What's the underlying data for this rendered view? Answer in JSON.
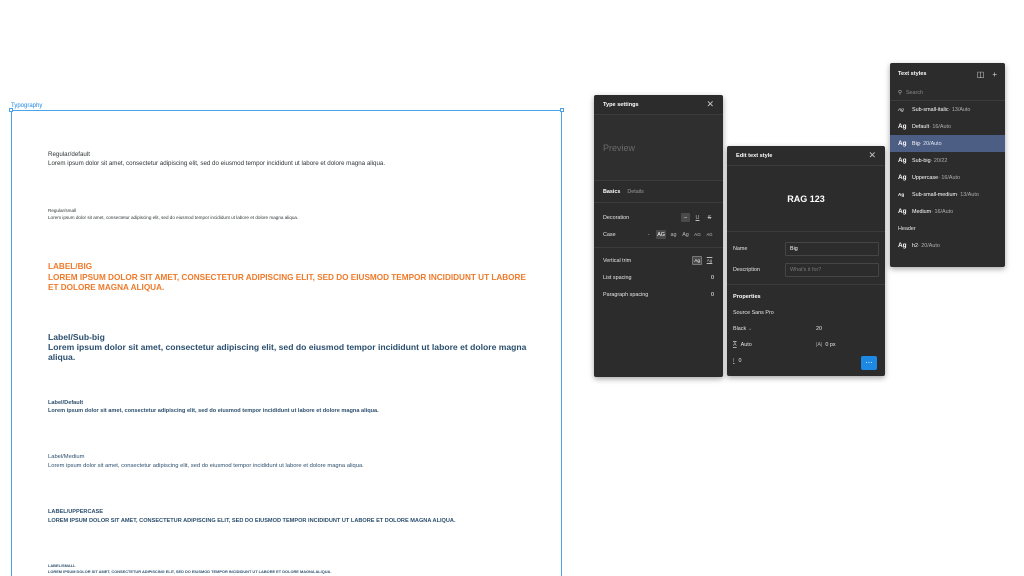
{
  "frame": {
    "label": "Typography"
  },
  "samples": [
    {
      "name": "Regular/default",
      "text": "Lorem ipsum dolor sit amet, consectetur adipiscing elit, sed do eiusmod tempor incididunt ut labore et dolore magna aliqua."
    },
    {
      "name": "Regular/small",
      "text": "Lorem ipsum dolor sit amet, consectetur adipiscing elit, sed do eiusmod tempor incididunt ut labore et dolore magna aliqua."
    },
    {
      "name": "LABEL/BIG",
      "text": "LOREM IPSUM DOLOR SIT AMET, CONSECTETUR ADIPISCING ELIT, SED DO EIUSMOD TEMPOR INCIDIDUNT UT LABORE ET DOLORE MAGNA ALIQUA."
    },
    {
      "name": "Label/Sub-big",
      "text": "Lorem ipsum dolor sit amet, consectetur adipiscing elit, sed do eiusmod tempor incididunt ut labore et dolore magna aliqua."
    },
    {
      "name": "Label/Default",
      "text": "Lorem ipsum dolor sit amet, consectetur adipiscing elit, sed do eiusmod tempor incididunt ut labore et dolore magna aliqua."
    },
    {
      "name": "Label/Medium",
      "text": "Lorem ipsum dolor sit amet, consectetur adipiscing elit, sed do eiusmod tempor incididunt ut labore et dolore magna aliqua."
    },
    {
      "name": "LABEL/UPPERCASE",
      "text": "LOREM IPSUM DOLOR SIT AMET, CONSECTETUR ADIPISCING ELIT, SED DO EIUSMOD TEMPOR INCIDIDUNT UT LABORE ET DOLORE MAGNA ALIQUA."
    },
    {
      "name": "LABEL/SMALL",
      "text": "LOREM IPSUM DOLOR SIT AMET, CONSECTETUR ADIPISCING ELIT, SED DO EIUSMOD TEMPOR INCIDIDUNT UT LABORE ET DOLORE MAGNA ALIQUA."
    }
  ],
  "type_settings": {
    "title": "Type settings",
    "preview": "Preview",
    "tabs": [
      "Basics",
      "Details"
    ],
    "decoration_label": "Decoration",
    "case_label": "Case",
    "case_options": [
      "-",
      "AG",
      "ag",
      "Ag",
      "AG",
      "AG"
    ],
    "vertical_trim_label": "Vertical trim",
    "list_spacing_label": "List spacing",
    "list_spacing_value": "0",
    "paragraph_spacing_label": "Paragraph spacing",
    "paragraph_spacing_value": "0"
  },
  "edit_text_style": {
    "title": "Edit text style",
    "preview": "RAG 123",
    "name_label": "Name",
    "name_value": "Big",
    "description_label": "Description",
    "description_placeholder": "What's it for?",
    "properties_label": "Properties",
    "font_family": "Source Sans Pro",
    "font_weight": "Black",
    "font_size": "20",
    "line_height": "Auto",
    "letter_spacing": "0 px",
    "paragraph_spacing": "0"
  },
  "text_styles": {
    "title": "Text styles",
    "search_placeholder": "Search",
    "items": [
      {
        "sample": "Ag",
        "name": "Sub-small-italic",
        "size": " · 13/Auto"
      },
      {
        "sample": "Ag",
        "name": "Default",
        "size": " · 16/Auto"
      },
      {
        "sample": "Ag",
        "name": "Big",
        "size": " · 20/Auto"
      },
      {
        "sample": "Ag",
        "name": "Sub-big",
        "size": " · 20/22"
      },
      {
        "sample": "Ag",
        "name": "Uppercase",
        "size": " · 16/Auto"
      },
      {
        "sample": "Ag",
        "name": "Sub-small-medium",
        "size": " · 13/Auto"
      },
      {
        "sample": "Ag",
        "name": "Medium",
        "size": " · 16/Auto"
      }
    ],
    "group": "Header",
    "group_items": [
      {
        "sample": "Ag",
        "name": "h2",
        "size": " · 20/Auto"
      }
    ],
    "selected": "Big"
  },
  "colors": {
    "accent_blue": "#1e88e5",
    "label_big_orange": "#ef7a2a",
    "label_navy": "#2b4f6e",
    "panel_bg": "#2c2c2c",
    "selected_row": "#4d5e84"
  }
}
